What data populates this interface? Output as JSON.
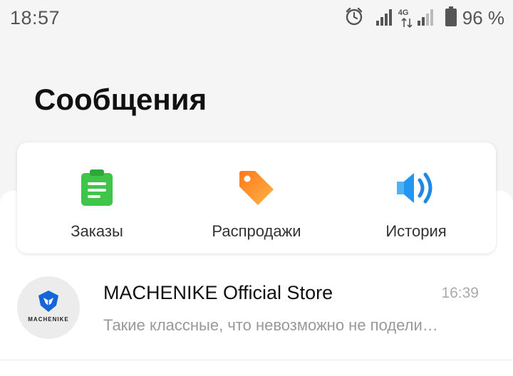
{
  "status_bar": {
    "time": "18:57",
    "network_label": "4G",
    "battery_percent": "96 %"
  },
  "page": {
    "title": "Сообщения"
  },
  "quick_actions": [
    {
      "label": "Заказы",
      "icon": "clipboard-icon",
      "color": "#3ec54a"
    },
    {
      "label": "Распродажи",
      "icon": "price-tag-icon",
      "color": "#ff8a1e"
    },
    {
      "label": "История",
      "icon": "speaker-icon",
      "color": "#1e88e5"
    }
  ],
  "chats": [
    {
      "name": "MACHENIKE Official Store",
      "time": "16:39",
      "preview": "Такие классные, что невозможно не подели…",
      "avatar_logo_text": "MACHENIKE"
    }
  ]
}
